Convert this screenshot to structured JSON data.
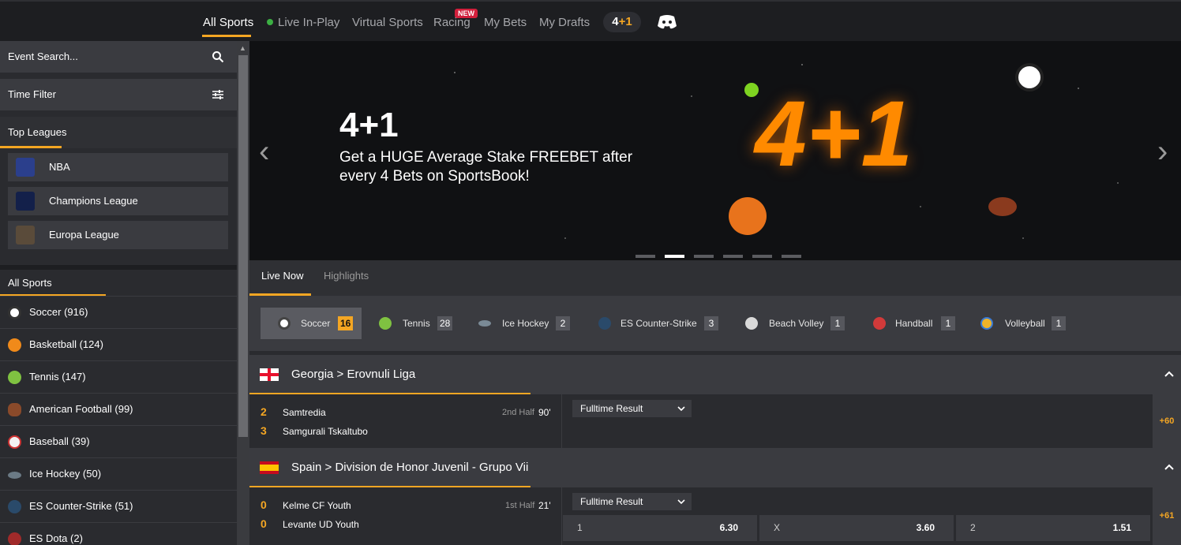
{
  "nav": {
    "tabs": [
      "All Sports",
      "Live In-Play",
      "Virtual Sports",
      "Racing",
      "My Bets",
      "My Drafts"
    ],
    "new_badge": "NEW",
    "promo_pill_num": "4",
    "promo_pill_plus": "+1"
  },
  "sidebar": {
    "search_placeholder": "Event Search...",
    "time_filter": "Time Filter",
    "top_leagues_title": "Top Leagues",
    "leagues": [
      "NBA",
      "Champions League",
      "Europa League"
    ],
    "all_sports_title": "All Sports",
    "sports": [
      "Soccer  (916)",
      "Basketball  (124)",
      "Tennis  (147)",
      "American Football  (99)",
      "Baseball  (39)",
      "Ice Hockey  (50)",
      "ES Counter-Strike  (51)",
      "ES Dota  (2)"
    ]
  },
  "banner": {
    "headline": "4+1",
    "text": "Get a HUGE Average Stake FREEBET after every 4 Bets on SportsBook!",
    "graphic_text": "4+1"
  },
  "subtabs": [
    "Live Now",
    "Highlights"
  ],
  "sport_chips": [
    {
      "label": "Soccer",
      "count": "16"
    },
    {
      "label": "Tennis",
      "count": "28"
    },
    {
      "label": "Ice Hockey",
      "count": "2"
    },
    {
      "label": "ES Counter-Strike",
      "count": "3"
    },
    {
      "label": "Beach Volley",
      "count": "1"
    },
    {
      "label": "Handball",
      "count": "1"
    },
    {
      "label": "Volleyball",
      "count": "1"
    }
  ],
  "matches": [
    {
      "league": "Georgia > Erovnuli Liga",
      "home_score": "2",
      "home": "Samtredia",
      "away_score": "3",
      "away": "Samgurali Tskaltubo",
      "period": "2nd Half",
      "minute": "90'",
      "market": "Fulltime Result",
      "more": "+60"
    },
    {
      "league": "Spain > Division de Honor Juvenil - Grupo Vii",
      "home_score": "0",
      "home": "Kelme CF Youth",
      "away_score": "0",
      "away": "Levante UD Youth",
      "period": "1st Half",
      "minute": "21'",
      "market": "Fulltime Result",
      "more": "+61",
      "odds": [
        {
          "label": "1",
          "price": "6.30"
        },
        {
          "label": "X",
          "price": "3.60"
        },
        {
          "label": "2",
          "price": "1.51"
        }
      ]
    }
  ],
  "colors": {
    "accent": "#f4a623",
    "live": "#3cb043",
    "badge": "#d21f3c"
  }
}
